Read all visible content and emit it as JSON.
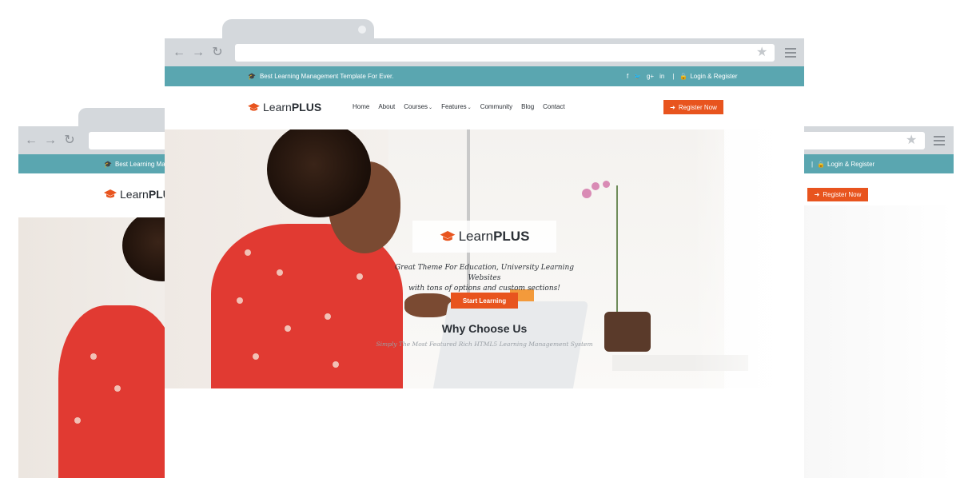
{
  "browser": {
    "back_icon": "←",
    "forward_icon": "→",
    "reload_icon": "↻",
    "star_icon": "★"
  },
  "topbar": {
    "tagline": "Best Learning Management Template For Ever.",
    "social": [
      "f",
      "🐦",
      "g+",
      "in"
    ],
    "divider": "|",
    "login_register": "Login & Register"
  },
  "left_window": {
    "topbar_tagline": "Best Learning Ma",
    "logo_light": "Learn",
    "logo_bold": "PLUS"
  },
  "right_window": {
    "topbar_prefix": "|",
    "login_register": "Login & Register",
    "register_label": "Register Now"
  },
  "header": {
    "logo_light": "Learn",
    "logo_bold": "PLUS",
    "nav": [
      {
        "label": "Home",
        "has_dropdown": false
      },
      {
        "label": "About",
        "has_dropdown": false
      },
      {
        "label": "Courses",
        "has_dropdown": true
      },
      {
        "label": "Features",
        "has_dropdown": true
      },
      {
        "label": "Community",
        "has_dropdown": false
      },
      {
        "label": "Blog",
        "has_dropdown": false
      },
      {
        "label": "Contact",
        "has_dropdown": false
      }
    ],
    "register_label": "Register Now"
  },
  "hero": {
    "logo_light": "Learn",
    "logo_bold": "PLUS",
    "tagline_line1": "Great Theme For Education, University Learning Websites",
    "tagline_line2": "with tons of options and custom sections!",
    "cta_label": "Start Learning"
  },
  "why": {
    "title": "Why Choose Us",
    "subtitle": "Simply The Most Featured Rich HTML5 Learning Management System"
  },
  "colors": {
    "accent": "#e8541e",
    "topbar": "#5aa6b0",
    "chrome": "#d4d8dc",
    "text": "#2a2f35"
  }
}
